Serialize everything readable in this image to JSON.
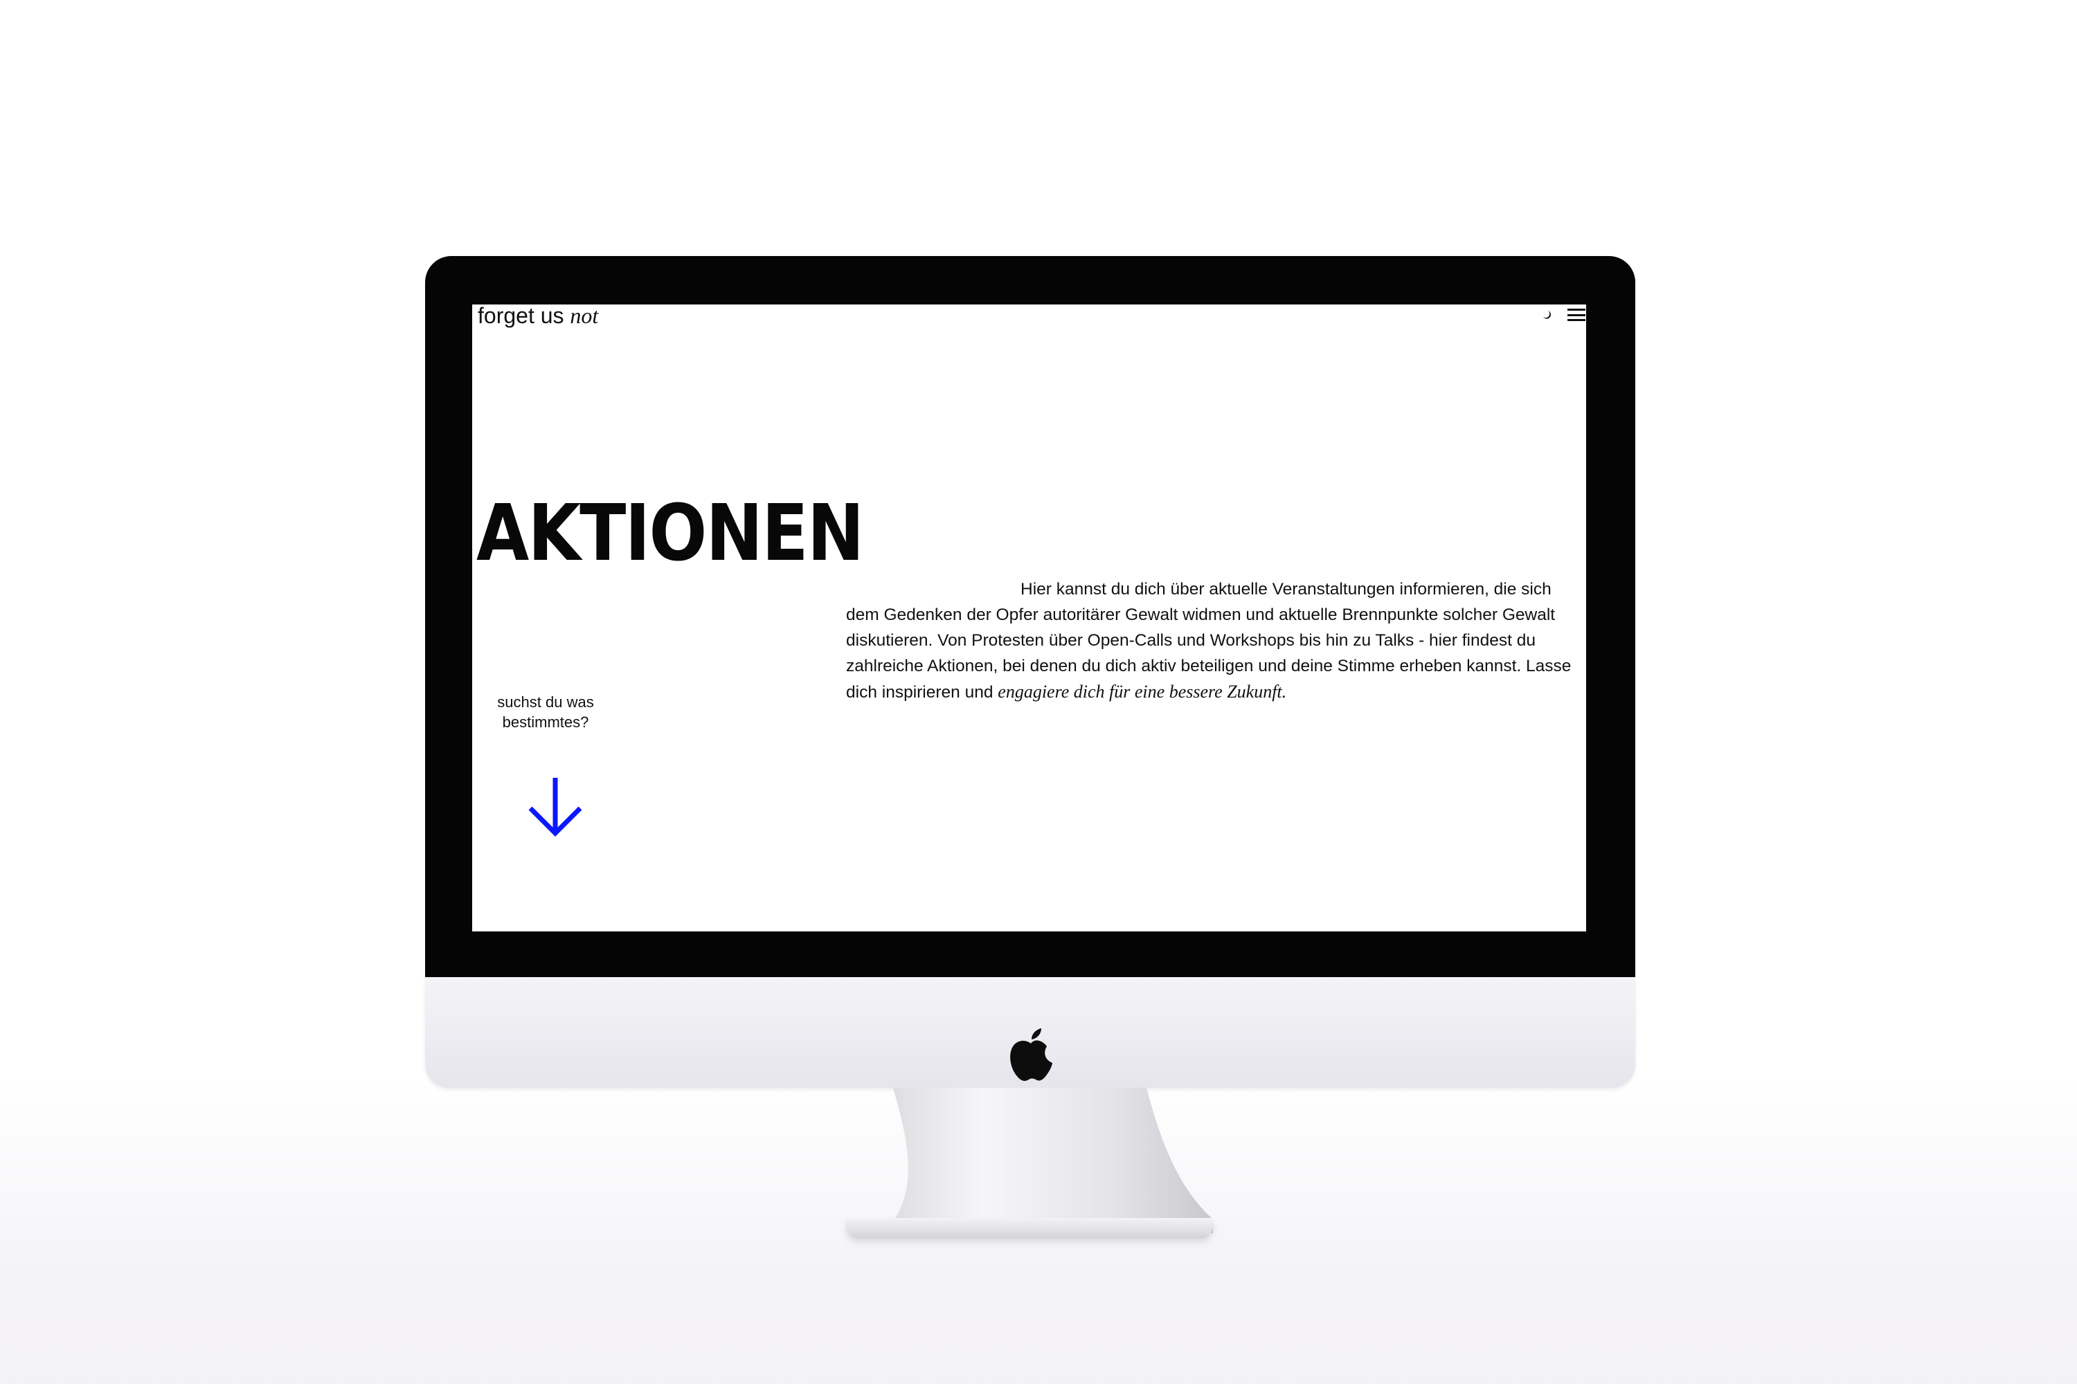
{
  "site": {
    "logo_text": "forget us",
    "logo_italic": "not"
  },
  "header": {
    "theme_icon": "moon-icon",
    "menu_icon": "hamburger-menu-icon"
  },
  "main": {
    "title": "AKTIONEN",
    "intro_text": "Hier kannst du dich über aktuelle Veranstaltungen informieren, die sich dem Gedenken der Opfer autoritärer Gewalt widmen und aktuelle Brennpunkte solcher Gewalt diskutieren. Von Protesten über Open-Calls und Workshops bis hin zu Talks - hier findest du zahlreiche Aktionen, bei denen du dich aktiv beteiligen und deine Stimme erheben kannst. Lasse dich inspirieren und ",
    "intro_italic": "engagiere dich für eine bessere Zukunft.",
    "search_hint": "suchst du was bestimmtes?"
  },
  "colors": {
    "accent": "#0a17ff",
    "text": "#111111",
    "background": "#ffffff"
  },
  "device": {
    "logo_icon": "apple-logo-icon"
  }
}
